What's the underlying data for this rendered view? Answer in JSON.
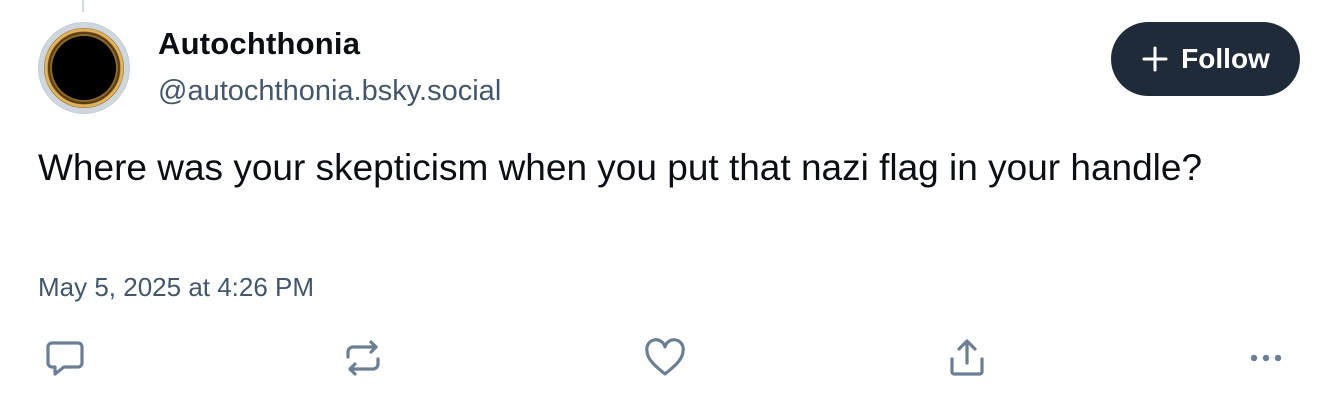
{
  "post": {
    "author": {
      "display_name": "Autochthonia",
      "handle": "@autochthonia.bsky.social",
      "avatar_icon": "ring-avatar"
    },
    "follow_button": {
      "label": "Follow",
      "icon": "plus-icon"
    },
    "text": "Where was your skepticism when you put that nazi flag in your handle?",
    "timestamp": "May 5, 2025 at 4:26 PM",
    "actions": [
      {
        "name": "reply",
        "icon": "speech-bubble-icon"
      },
      {
        "name": "repost",
        "icon": "repost-icon"
      },
      {
        "name": "like",
        "icon": "heart-icon"
      },
      {
        "name": "share",
        "icon": "share-icon"
      },
      {
        "name": "more",
        "icon": "more-dots-icon"
      }
    ]
  },
  "colors": {
    "text_primary": "#0b0f14",
    "text_secondary": "#42576c",
    "icon": "#6b7f94",
    "button_bg": "#1f2b38",
    "button_text": "#ffffff"
  }
}
